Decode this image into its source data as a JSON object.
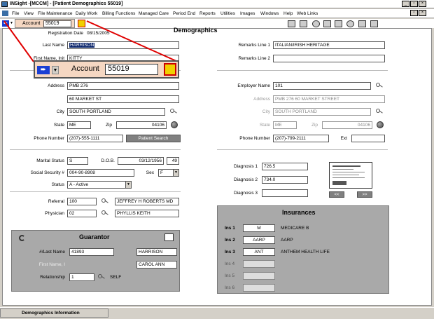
{
  "window": {
    "title": "INSight -[MCCM] - [Patient Demographics 55019]"
  },
  "menu": [
    "File",
    "View",
    "File Maintenance",
    "Daily Work",
    "Billing Functions",
    "Managed Care",
    "Period End",
    "Reports",
    "Utilities",
    "Images",
    "Windows",
    "Help",
    "Web Links"
  ],
  "toolbar": {
    "account_label": "Account",
    "account_value": "55019",
    "zoom_account_label": "Account",
    "zoom_account_value": "55019"
  },
  "form": {
    "heading": "Demographics",
    "registration_date_label": "Registration Date",
    "registration_date": "08/15/2005",
    "last_name_label": "Last Name",
    "last_name": "HARRISON",
    "first_name_label": "First Name, Init",
    "first_name": "KITTY",
    "address_label": "Address",
    "address1": "PMB 276",
    "address2": "60 MARKET ST",
    "city_label": "City",
    "city": "SOUTH PORTLAND",
    "state_label": "State",
    "state": "ME",
    "zip_label": "Zip",
    "zip": "04106",
    "phone_label": "Phone Number",
    "phone": "(207)-555-1111",
    "patient_search": "Patient Search",
    "marital_label": "Marital Status",
    "marital": "S",
    "dob_label": "D.O.B.",
    "dob": "03/12/1956",
    "age": "49",
    "ssn_label": "Social Security #",
    "ssn": "004-90-8908",
    "sex_label": "Sex",
    "sex": "F",
    "status_label": "Status",
    "status": "A - Active",
    "referral_label": "Referral",
    "referral_code": "100",
    "referral_name": "JEFFREY H ROBERTS MD",
    "physician_label": "Physician",
    "physician_code": "02",
    "physician_name": "PHYLLIS KEITH",
    "remarks1_label": "Remarks Line 1",
    "remarks1": "ITALIAN/IRISH HERITAGE",
    "remarks2_label": "Remarks Line 2",
    "remarks2": "",
    "employer_label": "Employer Name",
    "employer": "101",
    "emp_address_label": "Address",
    "emp_address": "PMB 276 60 MARKET STREET",
    "emp_city_label": "City",
    "emp_city": "SOUTH PORTLAND",
    "emp_state_label": "State",
    "emp_state": "ME",
    "emp_zip_label": "Zip",
    "emp_zip": "04106",
    "emp_phone_label": "Phone Number",
    "emp_phone": "(207)-799-2111",
    "ext_label": "Ext",
    "ext": "",
    "dx1_label": "Diagnosis 1",
    "dx1": "726.5",
    "dx2_label": "Diagnosis 2",
    "dx2": "734.0",
    "dx3_label": "Diagnosis 3",
    "dx3": "",
    "card_prev": "<<",
    "card_next": ">>"
  },
  "guarantor": {
    "title": "Guarantor",
    "last_label": "#/Last Name",
    "last_code": "41893",
    "last_name": "HARRISON",
    "first_label": "First Name, I",
    "first_name": "CAROL ANN",
    "rel_label": "Relationship",
    "rel_code": "1",
    "rel_text": "SELF"
  },
  "insurances": {
    "title": "Insurances",
    "rows": [
      {
        "label": "Ins 1",
        "code": "M",
        "name": "MEDICARE B"
      },
      {
        "label": "Ins 2",
        "code": "AARP",
        "name": "AARP"
      },
      {
        "label": "Ins 3",
        "code": "ANT",
        "name": "ANTHEM HEALTH LIFE"
      },
      {
        "label": "Ins 4",
        "code": "",
        "name": ""
      },
      {
        "label": "Ins 5",
        "code": "",
        "name": ""
      },
      {
        "label": "Ins 6",
        "code": "",
        "name": ""
      }
    ]
  },
  "status_bar": {
    "text": "Demographics Information"
  },
  "colors": {
    "selection": "#0a246a",
    "zoom_panel": "#f5d7c2",
    "callout_line": "#e00000",
    "panel_gray": "#a9a9a9"
  }
}
